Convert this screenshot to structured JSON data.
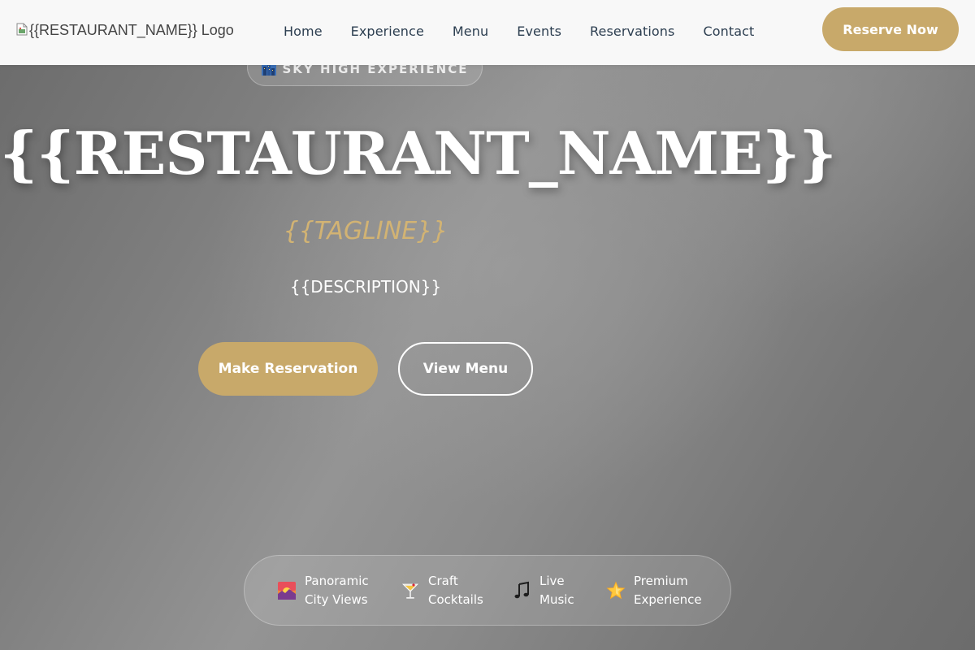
{
  "navbar": {
    "logo_alt": "{{RESTAURANT_NAME}} Logo",
    "links": [
      {
        "label": "Home"
      },
      {
        "label": "Experience"
      },
      {
        "label": "Menu"
      },
      {
        "label": "Events"
      },
      {
        "label": "Reservations"
      },
      {
        "label": "Contact"
      }
    ],
    "cta_label": "Reserve Now"
  },
  "hero": {
    "badge": {
      "icon": "cityscape-icon",
      "text": "SKY HIGH EXPERIENCE"
    },
    "title": "{{RESTAURANT_NAME}}",
    "tagline": "{{TAGLINE}}",
    "description": "{{DESCRIPTION}}",
    "primary_button": "Make Reservation",
    "secondary_button": "View Menu"
  },
  "features": [
    {
      "icon": "sunset-icon",
      "line1": "Panoramic",
      "line2": "City Views"
    },
    {
      "icon": "cocktail-icon",
      "line1": "Craft",
      "line2": "Cocktails"
    },
    {
      "icon": "music-note-icon",
      "line1": "Live",
      "line2": "Music"
    },
    {
      "icon": "star-icon",
      "line1": "Premium",
      "line2": "Experience"
    }
  ],
  "colors": {
    "accent_gold": "#c8a96a",
    "tagline_gold": "#d2b373",
    "nav_text": "#2c3e50",
    "navbar_bg": "#f8f8f8"
  }
}
